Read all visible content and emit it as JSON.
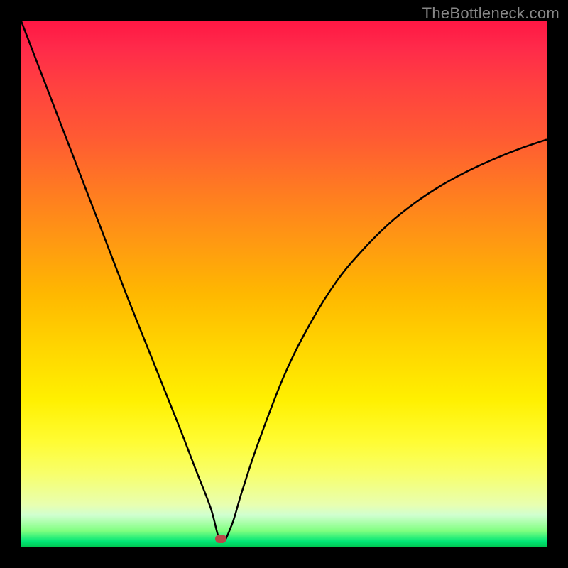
{
  "watermark": "TheBottleneck.com",
  "chart_data": {
    "type": "line",
    "title": "",
    "xlabel": "",
    "ylabel": "",
    "xlim": [
      0,
      100
    ],
    "ylim": [
      0,
      100
    ],
    "background": "rainbow-gradient-vertical",
    "marker": {
      "x": 38,
      "y": 1.5,
      "color": "#b84848"
    },
    "series": [
      {
        "name": "bottleneck-curve",
        "x": [
          0,
          5,
          10,
          15,
          20,
          25,
          30,
          33,
          36,
          38,
          40,
          42,
          45,
          50,
          55,
          60,
          65,
          70,
          75,
          80,
          85,
          90,
          95,
          100
        ],
        "values": [
          100,
          87,
          74,
          61,
          48,
          35.5,
          23,
          15.2,
          7.5,
          1,
          4,
          10.5,
          19.5,
          32.5,
          42.5,
          50.5,
          56.5,
          61.5,
          65.5,
          68.8,
          71.5,
          73.8,
          75.8,
          77.5
        ]
      }
    ]
  }
}
